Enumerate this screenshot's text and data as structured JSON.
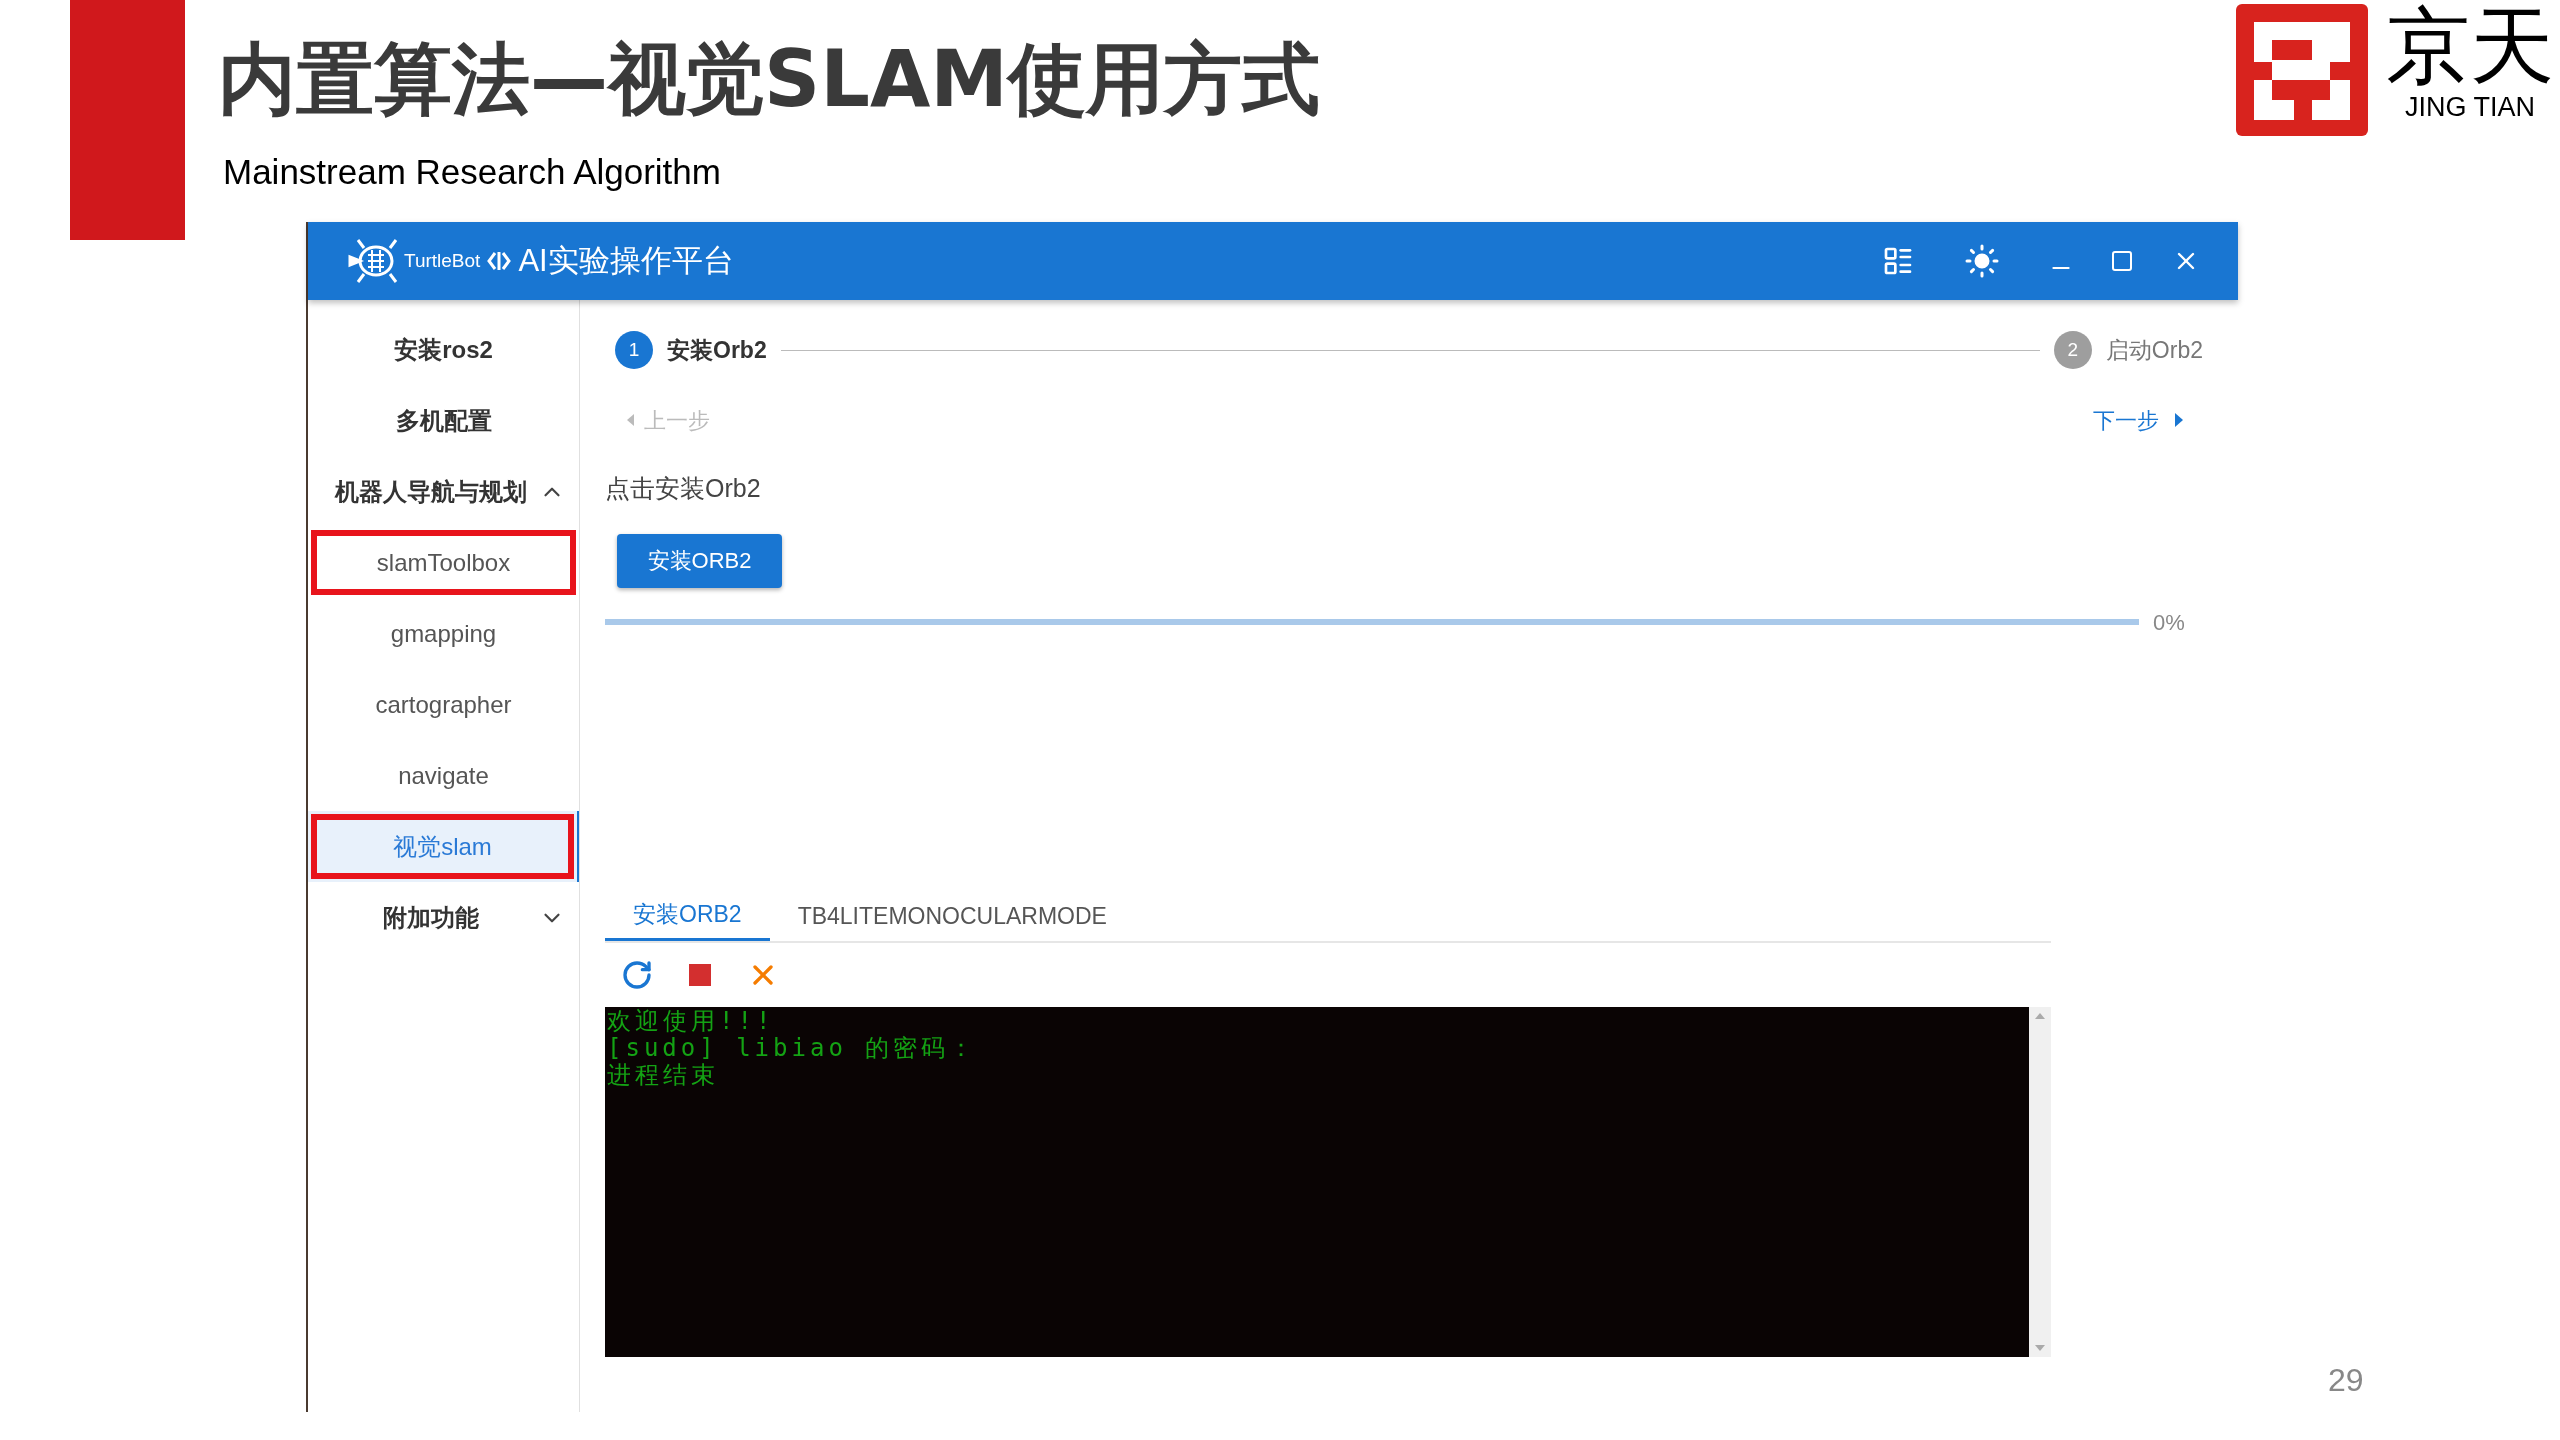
{
  "slide": {
    "title": "内置算法—视觉SLAM使用方式",
    "subtitle": "Mainstream Research Algorithm",
    "page_number": "29",
    "logo": {
      "text": "京天",
      "latin": "JING TIAN"
    }
  },
  "app": {
    "brand": "TurtleBot",
    "title": "AI实验操作平台",
    "sidebar": [
      {
        "kind": "item",
        "label": "安装ros2",
        "selected": false,
        "annotated": false
      },
      {
        "kind": "item",
        "label": "多机配置",
        "selected": false,
        "annotated": false
      },
      {
        "kind": "group",
        "label": "机器人导航与规划",
        "expanded": true,
        "children": [
          {
            "label": "slamToolbox",
            "selected": false,
            "annotated": true
          },
          {
            "label": "gmapping",
            "selected": false,
            "annotated": false
          },
          {
            "label": "cartographer",
            "selected": false,
            "annotated": false
          },
          {
            "label": "navigate",
            "selected": false,
            "annotated": false
          },
          {
            "label": "视觉slam",
            "selected": true,
            "annotated": true
          }
        ]
      },
      {
        "kind": "group",
        "label": "附加功能",
        "expanded": false
      }
    ],
    "steps": [
      {
        "number": "1",
        "label": "安装Orb2",
        "selected": true
      },
      {
        "number": "2",
        "label": "启动Orb2",
        "selected": false
      }
    ],
    "prev": {
      "label": "上一步",
      "disabled": true
    },
    "next": {
      "label": "下一步",
      "disabled": false
    },
    "instruction": "点击安装Orb2",
    "install_button": "安装ORB2",
    "progress": {
      "level": 0,
      "reading": "0%"
    },
    "tabs": [
      {
        "label": "安装ORB2",
        "selected": true
      },
      {
        "label": "TB4LITEMONOCULARMODE",
        "selected": false
      }
    ],
    "terminal": [
      "欢迎使用!!!",
      "[sudo] libiao 的密码：",
      "进程结束"
    ]
  }
}
